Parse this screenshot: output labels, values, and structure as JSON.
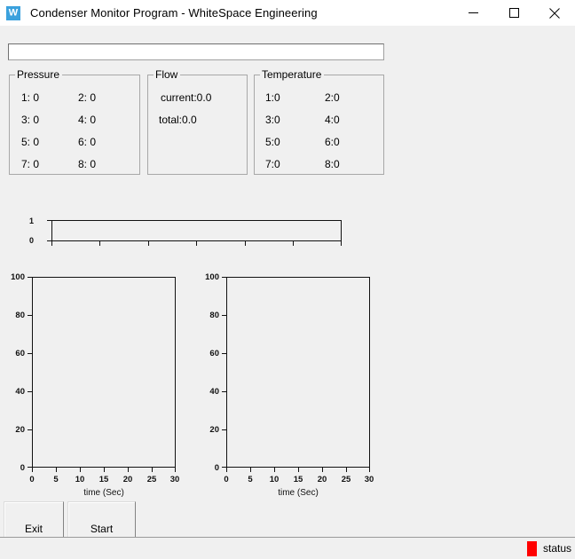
{
  "window": {
    "title": "Condenser Monitor Program - WhiteSpace Engineering",
    "icon": "app-logo-icon",
    "icon_glyph": "W",
    "icon_color": "#3ba1dd",
    "controls": {
      "minimize": "minimize-icon",
      "maximize": "maximize-icon",
      "close": "close-icon"
    }
  },
  "command_input": {
    "value": "",
    "placeholder": ""
  },
  "groups": {
    "pressure": {
      "title": "Pressure",
      "cells": [
        "1: 0",
        "2: 0",
        "3: 0",
        "4: 0",
        "5: 0",
        "6: 0",
        "7: 0",
        "8: 0"
      ]
    },
    "flow": {
      "title": "Flow",
      "cells": [
        "current:0.0",
        "total:0.0"
      ]
    },
    "temperature": {
      "title": "Temperature",
      "cells": [
        "1:0",
        "2:0",
        "3:0",
        "4:0",
        "5:0",
        "6:0",
        "7:0",
        "8:0"
      ]
    }
  },
  "chart_data": [
    {
      "name": "status-strip-chart",
      "type": "line",
      "title": "",
      "xlabel": "",
      "ylabel": "",
      "series": [
        {
          "name": "status",
          "values": []
        }
      ],
      "x": [],
      "xlim": [
        0,
        30
      ],
      "ylim": [
        0,
        1
      ],
      "yticks": [
        0,
        1
      ],
      "ytick_labels": [
        "0",
        "1"
      ],
      "xticks": [
        0,
        5,
        10,
        15,
        20,
        25,
        30
      ],
      "xtick_labels": [
        "",
        "",
        "",
        "",
        "",
        "",
        ""
      ],
      "grid": false,
      "legend": false
    },
    {
      "name": "pressure-chart",
      "type": "line",
      "title": "",
      "xlabel": "time (Sec)",
      "ylabel": "",
      "series": [
        {
          "name": "pressure",
          "values": []
        }
      ],
      "x": [],
      "xlim": [
        0,
        30
      ],
      "ylim": [
        0,
        100
      ],
      "yticks": [
        0,
        20,
        40,
        60,
        80,
        100
      ],
      "ytick_labels": [
        "0",
        "20",
        "40",
        "60",
        "80",
        "100"
      ],
      "xticks": [
        0,
        5,
        10,
        15,
        20,
        25,
        30
      ],
      "xtick_labels": [
        "0",
        "5",
        "10",
        "15",
        "20",
        "25",
        "30"
      ],
      "grid": false,
      "legend": false
    },
    {
      "name": "temperature-chart",
      "type": "line",
      "title": "",
      "xlabel": "time (Sec)",
      "ylabel": "",
      "series": [
        {
          "name": "temperature",
          "values": []
        }
      ],
      "x": [],
      "xlim": [
        0,
        30
      ],
      "ylim": [
        0,
        100
      ],
      "yticks": [
        0,
        20,
        40,
        60,
        80,
        100
      ],
      "ytick_labels": [
        "0",
        "20",
        "40",
        "60",
        "80",
        "100"
      ],
      "xticks": [
        0,
        5,
        10,
        15,
        20,
        25,
        30
      ],
      "xtick_labels": [
        "0",
        "5",
        "10",
        "15",
        "20",
        "25",
        "30"
      ],
      "grid": false,
      "legend": false
    }
  ],
  "buttons": {
    "exit": "Exit",
    "start": "Start"
  },
  "statusbar": {
    "indicator_color": "#ff0000",
    "text": "status"
  }
}
